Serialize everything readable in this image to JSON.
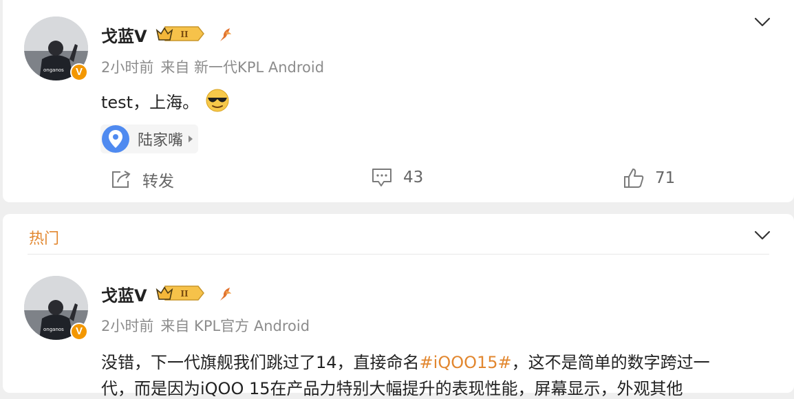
{
  "post": {
    "author_name": "戈蓝V",
    "meta_time": "2小时前",
    "meta_from": "来自 新一代KPL Android",
    "text": "test，上海。",
    "location": "陆家嘴",
    "actions": {
      "repost_label": "转发",
      "comment_count": "43",
      "like_count": "71"
    }
  },
  "hot": {
    "section_label": "热门",
    "author_name": "戈蓝V",
    "meta_time": "2小时前",
    "meta_from": "来自 KPL官方 Android",
    "text_pre": "没错，下一代旗舰我们跳过了14，直接命名",
    "hashtag": "#iQOO15#",
    "text_post": "，这不是简单的数字跨过一",
    "text_line2": "代，而是因为iQOO 15在产品力特别大幅提升的表现性能，屏幕显示，外观其他"
  },
  "badges": {
    "verified_letter": "V",
    "level_numeral": "II"
  },
  "colors": {
    "accent_orange": "#e2872f",
    "badge_orange": "#f39700",
    "location_blue": "#4f8af0"
  }
}
